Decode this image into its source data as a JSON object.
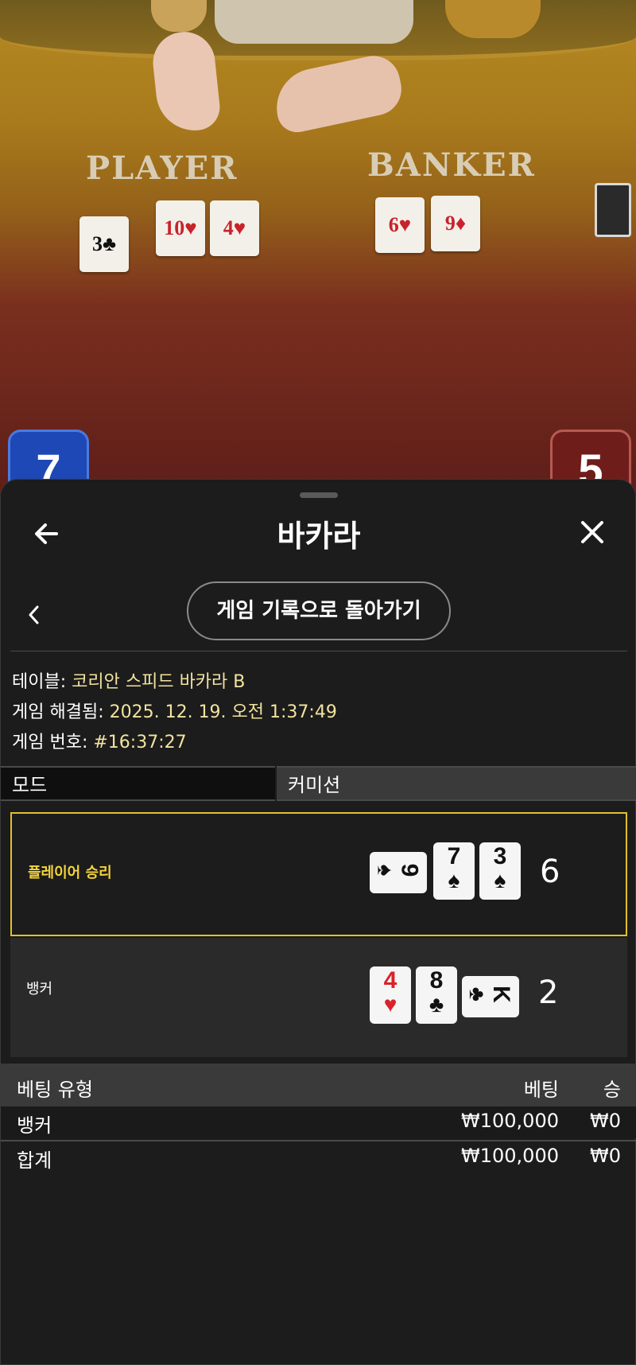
{
  "live_table": {
    "player_label": "PLAYER",
    "banker_label": "BANKER",
    "player_cards": [
      {
        "rank": "3",
        "suit": "♣",
        "color": "#111111"
      },
      {
        "rank": "10",
        "suit": "♥",
        "color": "#c8232b"
      },
      {
        "rank": "4",
        "suit": "♥",
        "color": "#c8232b"
      }
    ],
    "banker_cards": [
      {
        "rank": "6",
        "suit": "♥",
        "color": "#c8232b"
      },
      {
        "rank": "9",
        "suit": "♦",
        "color": "#c8232b"
      }
    ],
    "player_score": "7",
    "banker_score": "5"
  },
  "header": {
    "title": "바카라"
  },
  "nav": {
    "back_to_history": "게임 기록으로 돌아가기"
  },
  "info": {
    "table_label": "테이블:",
    "table_value": "코리안 스피드 바카라 B",
    "resolved_label": "게임 해결됨:",
    "resolved_value": "2025. 12. 19. 오전 1:37:49",
    "game_no_label": "게임 번호:",
    "game_no_value": "#16:37:27"
  },
  "tabs": {
    "mode": "모드",
    "commission": "커미션"
  },
  "results": {
    "player": {
      "label": "플레이어 승리",
      "score": "6",
      "cards": [
        {
          "rank": "9",
          "suit": "♠",
          "red": false,
          "rotated": true
        },
        {
          "rank": "7",
          "suit": "♠",
          "red": false,
          "rotated": false
        },
        {
          "rank": "3",
          "suit": "♠",
          "red": false,
          "rotated": false
        }
      ]
    },
    "banker": {
      "label": "뱅커",
      "score": "2",
      "cards": [
        {
          "rank": "4",
          "suit": "♥",
          "red": true,
          "rotated": false
        },
        {
          "rank": "8",
          "suit": "♣",
          "red": false,
          "rotated": false
        },
        {
          "rank": "K",
          "suit": "♣",
          "red": false,
          "rotated": true
        }
      ]
    }
  },
  "bets": {
    "headers": {
      "type": "베팅 유형",
      "bet": "베팅",
      "win": "승"
    },
    "rows": [
      {
        "type": "뱅커",
        "bet": "₩100,000",
        "win": "₩0"
      },
      {
        "type": "합계",
        "bet": "₩100,000",
        "win": "₩0"
      }
    ]
  },
  "colors": {
    "accent_gold": "#e2c12b",
    "player_blue": "#1e48b6",
    "banker_red": "#6f1d1a"
  }
}
